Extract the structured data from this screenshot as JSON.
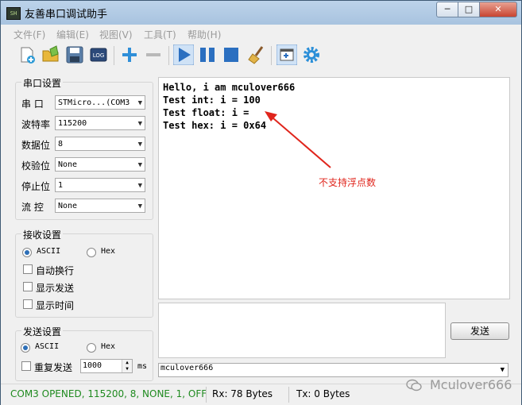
{
  "window": {
    "title": "友善串口调试助手",
    "app_icon_text": "SH"
  },
  "window_controls": {
    "minimize": "─",
    "maximize": "□",
    "close": "✕"
  },
  "menu": [
    "文件(F)",
    "编辑(E)",
    "视图(V)",
    "工具(T)",
    "帮助(H)"
  ],
  "toolbar": {
    "icons": [
      "new-file-icon",
      "open-folder-icon",
      "save-icon",
      "log-icon",
      "plus-icon",
      "minus-icon",
      "play-icon",
      "pause-icon",
      "stop-icon",
      "broom-icon",
      "window-icon",
      "gear-icon"
    ],
    "log_label": "LOG"
  },
  "serial_settings": {
    "title": "串口设置",
    "port": {
      "label": "串 口",
      "value": "STMicro...(COM3"
    },
    "baud": {
      "label": "波特率",
      "value": "115200"
    },
    "databits": {
      "label": "数据位",
      "value": "8"
    },
    "parity": {
      "label": "校验位",
      "value": "None"
    },
    "stopbits": {
      "label": "停止位",
      "value": "1"
    },
    "flow": {
      "label": "流 控",
      "value": "None"
    }
  },
  "receive_settings": {
    "title": "接收设置",
    "ascii_label": "ASCII",
    "hex_label": "Hex",
    "selected": "ASCII",
    "auto_wrap": "自动换行",
    "show_send": "显示发送",
    "show_time": "显示时间"
  },
  "send_settings": {
    "title": "发送设置",
    "ascii_label": "ASCII",
    "hex_label": "Hex",
    "selected": "ASCII",
    "repeat_label": "重复发送",
    "interval": "1000",
    "unit": "ms"
  },
  "receive_area": {
    "lines": [
      "Hello, i am mculover666",
      "Test int: i = 100",
      "Test float: i =",
      "Test hex: i = 0x64"
    ]
  },
  "annotation": {
    "text": "不支持浮点数",
    "color": "#e0251c"
  },
  "send_area": {
    "value": "",
    "send_button": "发送",
    "history_value": "mculover666"
  },
  "status": {
    "connection": "COM3 OPENED, 115200, 8, NONE, 1, OFF",
    "rx": "Rx: 78 Bytes",
    "tx": "Tx: 0 Bytes"
  },
  "watermark": {
    "text": "Mculover666"
  },
  "colors": {
    "status_green": "#1f8a1f",
    "accent_blue": "#2d6fb7",
    "annotation_red": "#e0251c"
  }
}
